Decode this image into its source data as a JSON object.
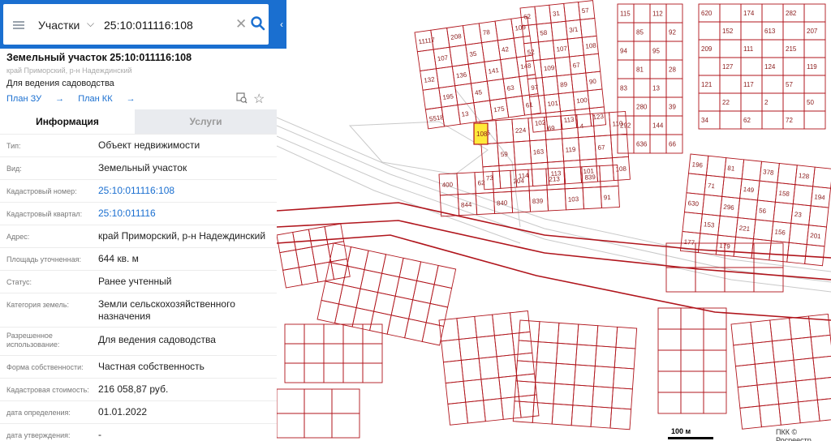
{
  "search": {
    "category": "Участки",
    "value": "25:10:011116:108"
  },
  "parcel": {
    "title": "Земельный участок 25:10:011116:108",
    "address_short": "край Приморский, р-н Надеждинский",
    "purpose": "Для ведения садоводства",
    "links": [
      "План ЗУ",
      "План КК"
    ]
  },
  "tabs": [
    "Информация",
    "Услуги"
  ],
  "attributes": [
    {
      "label": "Тип:",
      "value": "Объект недвижимости"
    },
    {
      "label": "Вид:",
      "value": "Земельный участок"
    },
    {
      "label": "Кадастровый номер:",
      "value": "25:10:011116:108",
      "link": true
    },
    {
      "label": "Кадастровый квартал:",
      "value": "25:10:011116",
      "link": true
    },
    {
      "label": "Адрес:",
      "value": "край Приморский, р-н Надеждинский"
    },
    {
      "label": "Площадь уточненная:",
      "value": "644 кв. м"
    },
    {
      "label": "Статус:",
      "value": "Ранее учтенный"
    },
    {
      "label": "Категория земель:",
      "value": "Земли сельскохозяйственного назначения"
    },
    {
      "label": "Разрешенное использование:",
      "value": "Для ведения садоводства"
    },
    {
      "label": "Форма собственности:",
      "value": "Частная собственность"
    },
    {
      "label": "Кадастровая стоимость:",
      "value": "216 058,87 руб."
    },
    {
      "label": "дата определения:",
      "value": "01.01.2022"
    },
    {
      "label": "дата утверждения:",
      "value": "-"
    }
  ],
  "map": {
    "parcel_labels": [
      "11117",
      "208",
      "78",
      "109",
      "107",
      "35",
      "42",
      "132",
      "136",
      "141",
      "148",
      "195",
      "45",
      "63",
      "5518",
      "13",
      "175",
      "61",
      "62",
      "31",
      "57",
      "58",
      "3/1",
      "52",
      "107",
      "108",
      "109",
      "67",
      "97",
      "89",
      "90",
      "101",
      "100",
      "102",
      "113",
      "123",
      "115",
      "112",
      "85",
      "92",
      "94",
      "95",
      "81",
      "28",
      "83",
      "13",
      "280",
      "39",
      "292",
      "144",
      "636",
      "66",
      "620",
      "174",
      "282",
      "152",
      "613",
      "207",
      "209",
      "111",
      "215",
      "127",
      "124",
      "119",
      "121",
      "117",
      "57",
      "22",
      "2",
      "50",
      "34",
      "62",
      "72",
      "65",
      "224",
      "69",
      "4",
      "110",
      "59",
      "163",
      "119",
      "67",
      "73",
      "114",
      "113",
      "101",
      "108",
      "400",
      "62",
      "204",
      "213",
      "839",
      "844",
      "840",
      "839",
      "103",
      "91",
      "196",
      "81",
      "378",
      "128",
      "71",
      "149",
      "158",
      "194",
      "630",
      "296",
      "56",
      "23",
      "153",
      "221",
      "156",
      "201",
      "177",
      "179"
    ],
    "selected_parcel": "108",
    "scale_label": "100 м",
    "copyright": "ПКК © Росреестр"
  },
  "colors": {
    "accent": "#1a6fd0",
    "boundary": "#b0151c",
    "selected": "#ffea3b"
  }
}
